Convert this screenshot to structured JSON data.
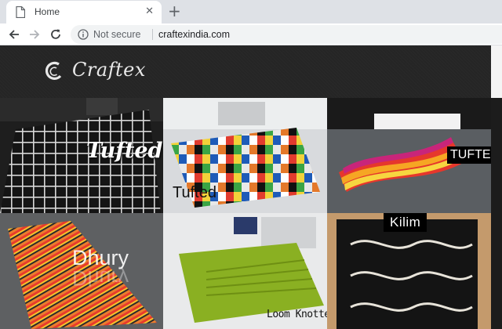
{
  "browser": {
    "tab": {
      "title": "Home",
      "close_icon": "close-icon"
    },
    "new_tab_icon": "plus-icon",
    "security_text": "Not secure",
    "url": "craftexindia.com"
  },
  "site": {
    "logo_text": "Craftex",
    "tiles": [
      {
        "label": "Tufted",
        "theme": "black grid rug"
      },
      {
        "label": "Tufted",
        "theme": "colorful patchwork rug"
      },
      {
        "label": "TUFTED",
        "theme": "rainbow wave rug"
      },
      {
        "label": "Dhury",
        "reflection": "Dhury",
        "theme": "striped rug"
      },
      {
        "label": "Loom Knotted",
        "theme": "green rug"
      },
      {
        "label": "Kilim",
        "theme": "black fish kilim"
      }
    ]
  },
  "colors": {
    "header_bg": "#252525",
    "tab_strip": "#dee1e6",
    "omnibox_bg": "#f1f3f4"
  }
}
